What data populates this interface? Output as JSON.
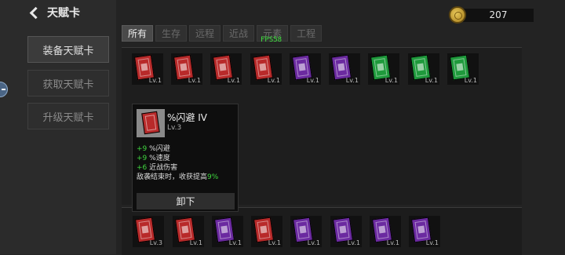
{
  "header": {
    "back_label": "天赋卡"
  },
  "sidebar": {
    "items": [
      {
        "label": "装备天赋卡",
        "active": true
      },
      {
        "label": "获取天赋卡",
        "active": false
      },
      {
        "label": "升级天赋卡",
        "active": false
      }
    ]
  },
  "currency": {
    "amount": "207",
    "icon": "gold-coin-icon"
  },
  "tabs": [
    {
      "label": "所有",
      "active": true
    },
    {
      "label": "生存",
      "active": false
    },
    {
      "label": "远程",
      "active": false
    },
    {
      "label": "近战",
      "active": false
    },
    {
      "label": "元素",
      "active": false
    },
    {
      "label": "工程",
      "active": false
    }
  ],
  "fps": "FPS58",
  "inventory": [
    {
      "color": "red",
      "level": "Lv.1"
    },
    {
      "color": "red",
      "level": "Lv.1"
    },
    {
      "color": "red",
      "level": "Lv.1"
    },
    {
      "color": "red",
      "level": "Lv.1"
    },
    {
      "color": "purple",
      "level": "Lv.1"
    },
    {
      "color": "purple",
      "level": "Lv.1"
    },
    {
      "color": "green",
      "level": "Lv.1"
    },
    {
      "color": "green",
      "level": "Lv.1"
    },
    {
      "color": "green",
      "level": "Lv.1"
    }
  ],
  "popup": {
    "title": "%闪避 IV",
    "level": "Lv.3",
    "stats": [
      {
        "value": "+9",
        "label": "%闪避"
      },
      {
        "value": "+9",
        "label": "%速度"
      },
      {
        "value": "+6",
        "label": "近战伤害"
      }
    ],
    "desc_prefix": "敌袭结束时，收获提高",
    "desc_value": "9%",
    "button_label": "卸下"
  },
  "equipped": [
    {
      "color": "red",
      "level": "Lv.3"
    },
    {
      "color": "red",
      "level": "Lv.1"
    },
    {
      "color": "purple",
      "level": "Lv.1"
    },
    {
      "color": "red",
      "level": "Lv.1"
    },
    {
      "color": "purple",
      "level": "Lv.1"
    },
    {
      "color": "purple",
      "level": "Lv.1"
    },
    {
      "color": "purple",
      "level": "Lv.1"
    },
    {
      "color": "purple",
      "level": "Lv.1"
    }
  ],
  "colors": {
    "red": "#b82a2a",
    "purple": "#6b2aa0",
    "green": "#1f9a3c",
    "accent_green": "#3fd63f"
  }
}
